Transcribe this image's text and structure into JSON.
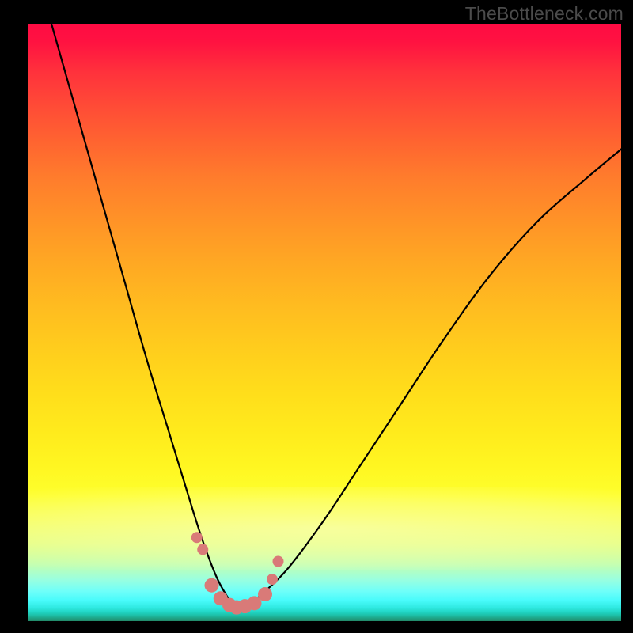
{
  "watermark": "TheBottleneck.com",
  "chart_data": {
    "type": "line",
    "title": "",
    "xlabel": "",
    "ylabel": "",
    "xlim": [
      0,
      100
    ],
    "ylim": [
      0,
      100
    ],
    "grid": false,
    "legend": false,
    "note": "Background vertical gradient encodes a scalar from high (red, top) to optimal (green, bottom). Black curve is a V-shaped profile with minimum near x≈35 at y≈2. Salmon dots mark selected points near the trough.",
    "series": [
      {
        "name": "curve",
        "color": "#000000",
        "x": [
          4,
          8,
          12,
          16,
          20,
          24,
          28,
          30,
          32,
          34,
          35,
          36,
          38,
          40,
          44,
          50,
          56,
          62,
          70,
          78,
          86,
          94,
          100
        ],
        "y": [
          100,
          86,
          72,
          58,
          44,
          31,
          18,
          12,
          7,
          3.5,
          2.3,
          2.5,
          3.4,
          5,
          9,
          17,
          26,
          35,
          47,
          58,
          67,
          74,
          79
        ]
      },
      {
        "name": "markers",
        "color": "#d97a78",
        "x": [
          28.5,
          29.5,
          31.0,
          32.5,
          34.0,
          35.2,
          36.6,
          38.2,
          40.0,
          41.2,
          42.2
        ],
        "y": [
          14.0,
          12.0,
          6.0,
          3.8,
          2.7,
          2.3,
          2.5,
          3.0,
          4.5,
          7.0,
          10.0
        ]
      }
    ]
  }
}
